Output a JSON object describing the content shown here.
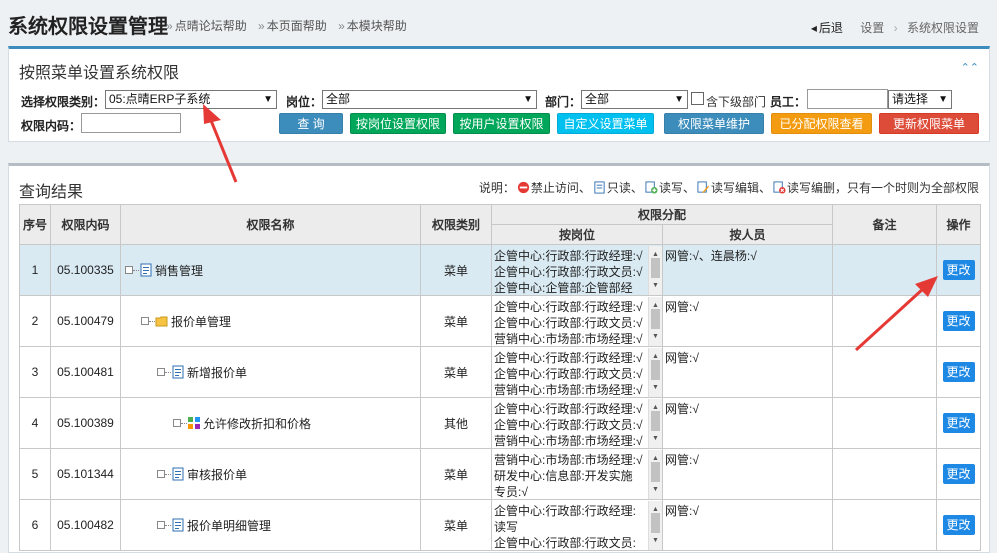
{
  "header": {
    "title": "系统权限设置管理",
    "help_links": [
      "点晴论坛帮助",
      "本页面帮助",
      "本模块帮助"
    ],
    "back": "后退",
    "breadcrumb": [
      "设置",
      "系统权限设置"
    ]
  },
  "filter_panel": {
    "title": "按照菜单设置系统权限",
    "category_label": "选择权限类别：",
    "category_value": "05:点晴ERP子系统",
    "post_label": "岗位：",
    "post_value": "全部",
    "dept_label": "部门：",
    "dept_value": "全部",
    "subdept_label": "含下级部门",
    "staff_label": "员工：",
    "staff_select": "请选择",
    "code_label": "权限内码：",
    "buttons": {
      "query": "查 询",
      "by_post": "按岗位设置权限",
      "by_user": "按用户设置权限",
      "custom_menu": "自定义设置菜单",
      "menu_maint": "权限菜单维护",
      "assigned": "已分配权限查看",
      "refresh": "更新权限菜单"
    }
  },
  "results": {
    "title": "查询结果",
    "legend_prefix": "说明：",
    "legend_items": [
      "禁止访问、",
      "只读、",
      "读写、",
      "读写编辑、",
      "读写编删"
    ],
    "legend_suffix": "，只有一个时则为全部权限",
    "headers": {
      "no": "序号",
      "code": "权限内码",
      "name": "权限名称",
      "type": "权限类别",
      "alloc": "权限分配",
      "by_post": "按岗位",
      "by_person": "按人员",
      "remark": "备注",
      "op": "操作"
    },
    "rows": [
      {
        "no": "1",
        "code": "05.100335",
        "name": "销售管理",
        "type": "菜单",
        "posts": [
          "企管中心:行政部:行政经理:√",
          "企管中心:行政部:行政文员:√",
          "企管中心:企管部:企管部经"
        ],
        "person": "网管:√、连晨杨:√",
        "action": "更改"
      },
      {
        "no": "2",
        "code": "05.100479",
        "name": "报价单管理",
        "type": "菜单",
        "posts": [
          "企管中心:行政部:行政经理:√",
          "企管中心:行政部:行政文员:√",
          "营销中心:市场部:市场经理:√"
        ],
        "person": "网管:√",
        "action": "更改"
      },
      {
        "no": "3",
        "code": "05.100481",
        "name": "新增报价单",
        "type": "菜单",
        "posts": [
          "企管中心:行政部:行政经理:√",
          "企管中心:行政部:行政文员:√",
          "营销中心:市场部:市场经理:√"
        ],
        "person": "网管:√",
        "action": "更改"
      },
      {
        "no": "4",
        "code": "05.100389",
        "name": "允许修改折扣和价格",
        "type": "其他",
        "posts": [
          "企管中心:行政部:行政经理:√",
          "企管中心:行政部:行政文员:√",
          "营销中心:市场部:市场经理:√"
        ],
        "person": "网管:√",
        "action": "更改"
      },
      {
        "no": "5",
        "code": "05.101344",
        "name": "审核报价单",
        "type": "菜单",
        "posts": [
          "营销中心:市场部:市场经理:√",
          "研发中心:信息部:开发实施",
          "专员:√"
        ],
        "person": "网管:√",
        "action": "更改"
      },
      {
        "no": "6",
        "code": "05.100482",
        "name": "报价单明细管理",
        "type": "菜单",
        "posts": [
          "企管中心:行政部:行政经理:",
          "读写",
          "企管中心:行政部:行政文员:"
        ],
        "person": "网管:√",
        "action": "更改"
      }
    ]
  },
  "colors": {
    "accent": "#3c8dbc",
    "highlight_row": "#d9eaf3",
    "edit_button": "#1e88e5",
    "annotation_arrow": "#e53935"
  }
}
